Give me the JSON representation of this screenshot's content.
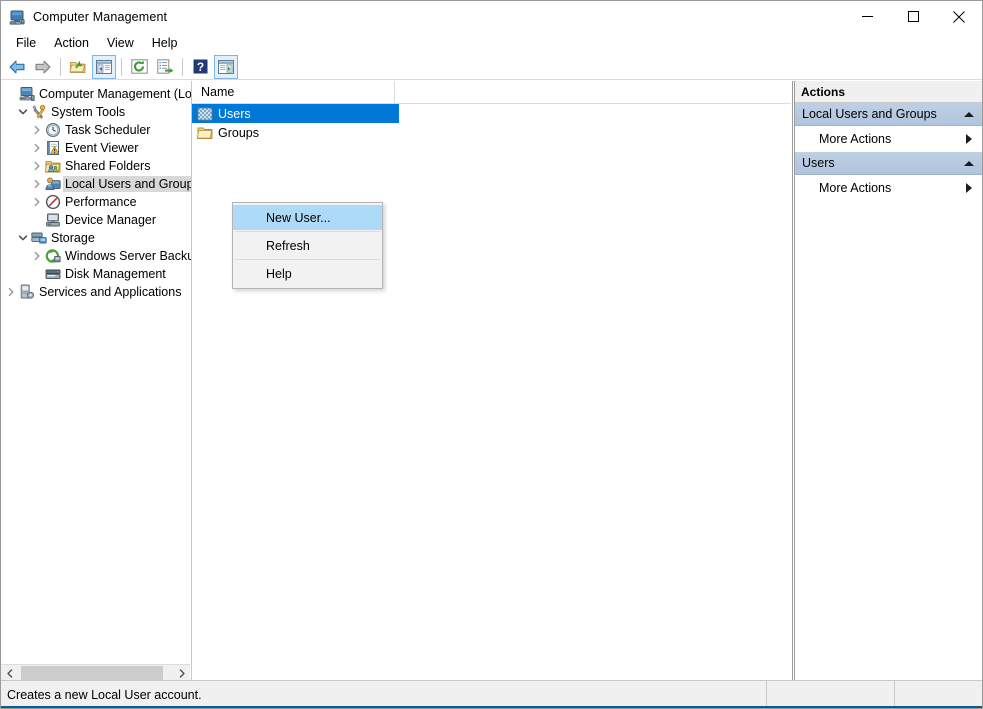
{
  "window": {
    "title": "Computer Management",
    "title_icon": "computer-management-icon",
    "controls": {
      "minimize": "minimize-icon",
      "maximize": "maximize-icon",
      "close": "close-icon"
    }
  },
  "menubar": {
    "items": [
      {
        "label": "File"
      },
      {
        "label": "Action"
      },
      {
        "label": "View"
      },
      {
        "label": "Help"
      }
    ]
  },
  "toolbar": {
    "buttons": [
      {
        "name": "back-icon",
        "framed": false
      },
      {
        "name": "forward-icon",
        "framed": false
      },
      {
        "name": "separator",
        "framed": false
      },
      {
        "name": "up-folder-icon",
        "framed": false
      },
      {
        "name": "show-hide-console-tree-icon",
        "framed": true
      },
      {
        "name": "separator",
        "framed": false
      },
      {
        "name": "refresh-icon",
        "framed": false
      },
      {
        "name": "export-list-icon",
        "framed": false
      },
      {
        "name": "separator",
        "framed": false
      },
      {
        "name": "help-icon",
        "framed": false
      },
      {
        "name": "show-hide-action-pane-icon",
        "framed": true
      }
    ]
  },
  "tree": {
    "nodes": [
      {
        "label": "Computer Management (Local",
        "icon": "computer-icon",
        "indent": 0,
        "twist": "none",
        "selected": false
      },
      {
        "label": "System Tools",
        "icon": "system-tools-icon",
        "indent": 1,
        "twist": "down",
        "selected": false
      },
      {
        "label": "Task Scheduler",
        "icon": "clock-icon",
        "indent": 2,
        "twist": "right",
        "selected": false
      },
      {
        "label": "Event Viewer",
        "icon": "event-viewer-icon",
        "indent": 2,
        "twist": "right",
        "selected": false
      },
      {
        "label": "Shared Folders",
        "icon": "shared-folders-icon",
        "indent": 2,
        "twist": "right",
        "selected": false
      },
      {
        "label": "Local Users and Groups",
        "icon": "local-users-groups-icon",
        "indent": 2,
        "twist": "right",
        "selected": true
      },
      {
        "label": "Performance",
        "icon": "performance-icon",
        "indent": 2,
        "twist": "right",
        "selected": false
      },
      {
        "label": "Device Manager",
        "icon": "device-manager-icon",
        "indent": 2,
        "twist": "none",
        "selected": false
      },
      {
        "label": "Storage",
        "icon": "storage-icon",
        "indent": 1,
        "twist": "down",
        "selected": false
      },
      {
        "label": "Windows Server Backup",
        "icon": "windows-server-backup-icon",
        "indent": 2,
        "twist": "right",
        "selected": false
      },
      {
        "label": "Disk Management",
        "icon": "disk-management-icon",
        "indent": 2,
        "twist": "none",
        "selected": false
      },
      {
        "label": "Services and Applications",
        "icon": "services-applications-icon",
        "indent": 1,
        "twist": "right",
        "selected": false
      }
    ]
  },
  "list": {
    "columns": [
      {
        "label": "Name"
      }
    ],
    "rows": [
      {
        "label": "Users",
        "icon": "users-folder-icon",
        "selected": true
      },
      {
        "label": "Groups",
        "icon": "groups-folder-icon",
        "selected": false
      }
    ]
  },
  "context_menu": {
    "items": [
      {
        "label": "New User...",
        "highlight": true
      },
      {
        "label": "Refresh",
        "highlight": false
      },
      {
        "label": "Help",
        "highlight": false
      }
    ]
  },
  "actions": {
    "title": "Actions",
    "groups": [
      {
        "header": "Local Users and Groups",
        "collapse_icon": "chevron-up-icon",
        "items": [
          {
            "label": "More Actions",
            "submenu_icon": "chevron-right-icon"
          }
        ]
      },
      {
        "header": "Users",
        "collapse_icon": "chevron-up-icon",
        "items": [
          {
            "label": "More Actions",
            "submenu_icon": "chevron-right-icon"
          }
        ]
      }
    ]
  },
  "statusbar": {
    "message": "Creates a new Local User account.",
    "segment2": "",
    "segment3": ""
  },
  "scrollbar": {
    "left_arrow": "chevron-left-icon",
    "right_arrow": "chevron-right-icon"
  },
  "colors": {
    "selection_blue": "#0078d7",
    "menu_highlight": "#addaf7",
    "action_header": "#b0c4dd",
    "accent_bottom": "#0d5a8f"
  }
}
